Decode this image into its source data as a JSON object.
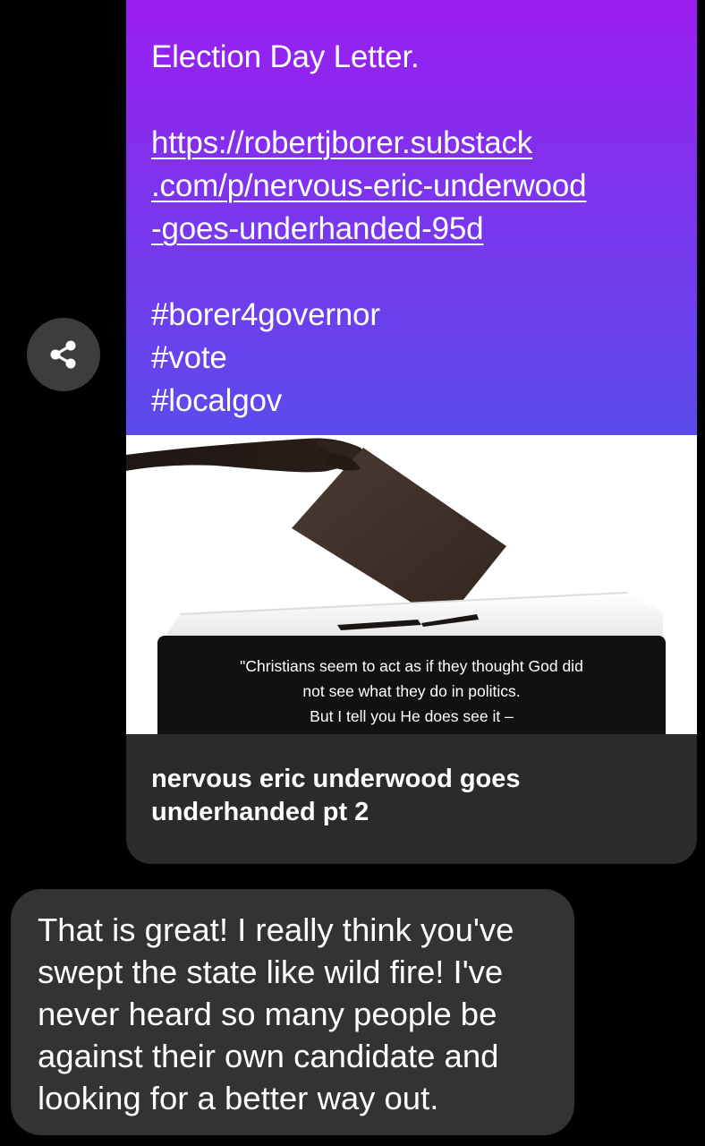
{
  "sent_message": {
    "title": "Election Day Letter.",
    "link_lines": [
      "https://robertjborer.substack",
      ".com/p/nervous-eric-underwood",
      "-goes-underhanded-95d"
    ],
    "hashtags": [
      "#borer4governor",
      "#vote",
      "#localgov"
    ],
    "link_preview": {
      "quote_lines": [
        "\"Christians seem to act as if they thought God did",
        "not see what they do in politics.",
        "But I tell you He does see it –"
      ],
      "title_lines": [
        "nervous eric underwood goes",
        "underhanded pt 2"
      ]
    }
  },
  "share_button": {
    "icon": "share-icon"
  },
  "received_message": {
    "lines": [
      "That is great! I really think you've",
      "swept the state like wild fire! I've",
      "never heard so many people be",
      "against their own candidate and",
      "looking for a better way out."
    ]
  },
  "colors": {
    "background": "#000000",
    "sent_gradient_top": "#9a1df0",
    "sent_gradient_bottom": "#5b4bec",
    "preview_footer": "#2b2b2b",
    "received_bubble": "#333333",
    "share_button": "#3d3d3d"
  }
}
